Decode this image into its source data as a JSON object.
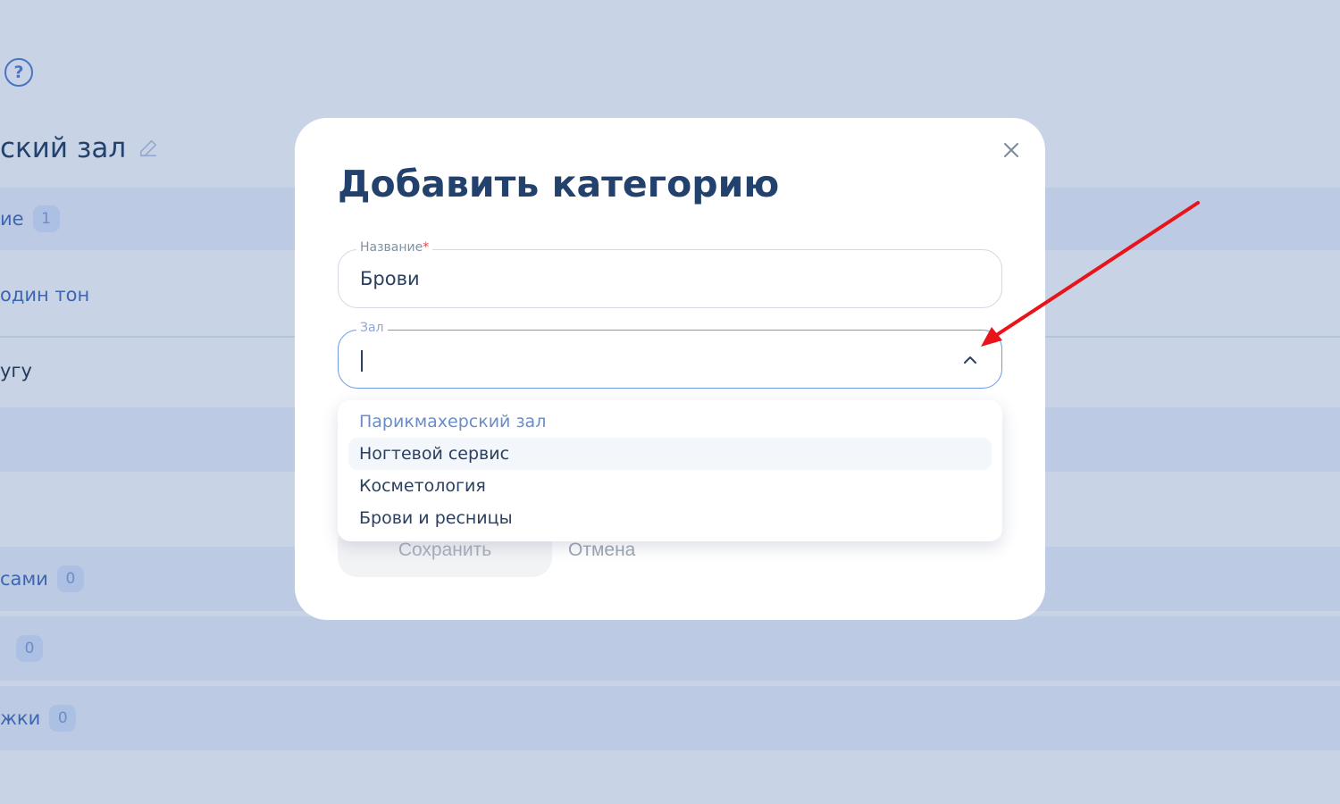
{
  "background": {
    "help_icon": "?",
    "title": "ский зал",
    "rows": [
      {
        "label": "ие",
        "badge": "1"
      },
      {
        "label": "один тон",
        "badge": ""
      },
      {
        "label": "угу",
        "badge": ""
      },
      {
        "label": "сами",
        "badge": "0"
      },
      {
        "label": "",
        "badge": "0"
      },
      {
        "label": "жки",
        "badge": "0"
      }
    ]
  },
  "modal": {
    "title": "Добавить категорию",
    "name_field": {
      "label": "Название",
      "required_mark": "*",
      "value": "Брови"
    },
    "hall_field": {
      "label": "Зал",
      "value": ""
    },
    "dropdown": {
      "options": [
        {
          "label": "Парикмахерский зал",
          "selected": true
        },
        {
          "label": "Ногтевой сервис",
          "hovered": true
        },
        {
          "label": "Косметология"
        },
        {
          "label": "Брови и ресницы"
        }
      ]
    },
    "buttons": {
      "save": "Сохранить",
      "cancel": "Отмена"
    }
  },
  "colors": {
    "accent": "#6f98e6",
    "title": "#22416d",
    "overlay": "#c8d4e6",
    "annotation": "#e8141a"
  }
}
